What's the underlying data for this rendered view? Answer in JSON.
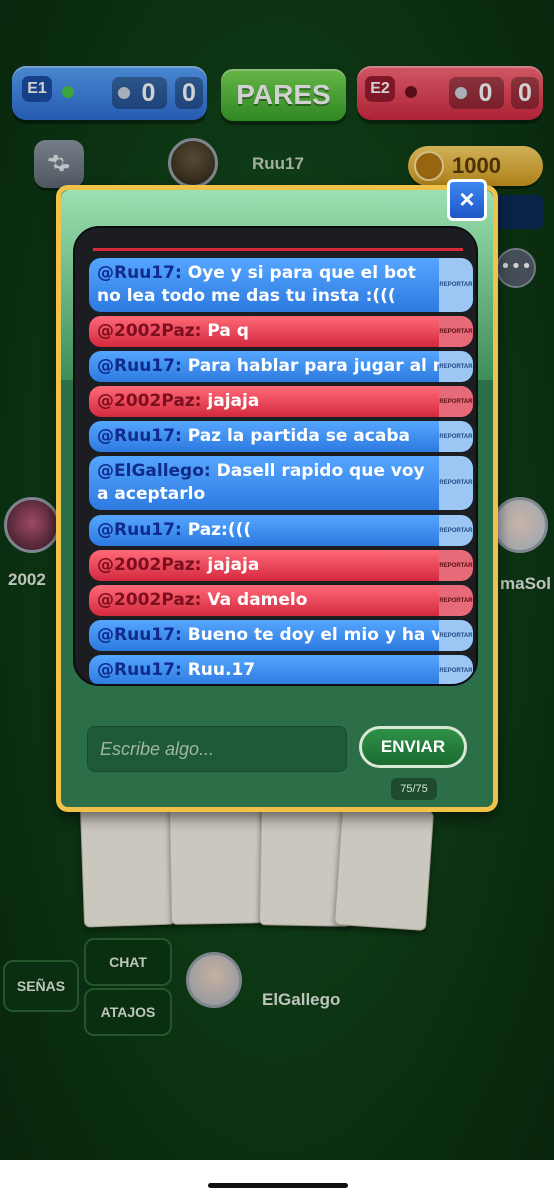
{
  "header": {
    "team1": {
      "label": "E1",
      "score_a": "0",
      "score_b": "0",
      "color": "#2f6fd6"
    },
    "phase_label": "PARES",
    "team2": {
      "label": "E2",
      "score_a": "0",
      "score_b": "0",
      "color": "#d42b41"
    }
  },
  "players": {
    "top": {
      "name": "Ruu17"
    },
    "left": {
      "name": "2002"
    },
    "right": {
      "name": "maSol"
    },
    "bottom": {
      "name": "ElGallego"
    }
  },
  "coins": {
    "value": "1000"
  },
  "controls": {
    "senas_label": "SEÑAS",
    "chat_label": "CHAT",
    "atajos_label": "ATAJOS"
  },
  "chat": {
    "close_label": "×",
    "report_label": "REPORTAR",
    "messages": [
      {
        "user": "@Ruu17:",
        "text": "Oye y si para que el bot no lea todo me das tu insta :(((",
        "color": "blue"
      },
      {
        "user": "@2002Paz:",
        "text": "Pa q",
        "color": "red"
      },
      {
        "user": "@Ruu17:",
        "text": "Para hablar para jugar al mus :/",
        "color": "blue"
      },
      {
        "user": "@2002Paz:",
        "text": "jajaja",
        "color": "red"
      },
      {
        "user": "@Ruu17:",
        "text": "Paz la partida se acaba",
        "color": "blue"
      },
      {
        "user": "@ElGallego:",
        "text": "Dasell rapido que voy a aceptarlo",
        "color": "blue"
      },
      {
        "user": "@Ruu17:",
        "text": "Paz:(((",
        "color": "blue"
      },
      {
        "user": "@2002Paz:",
        "text": "jajaja",
        "color": "red"
      },
      {
        "user": "@2002Paz:",
        "text": "Va damelo",
        "color": "red"
      },
      {
        "user": "@Ruu17:",
        "text": "Bueno te doy el mio y ha vesssss",
        "color": "blue"
      },
      {
        "user": "@Ruu17:",
        "text": "Ruu.17",
        "color": "blue"
      }
    ],
    "input_placeholder": "Escribe algo...",
    "send_label": "ENVIAR",
    "char_counter": "75/75"
  }
}
